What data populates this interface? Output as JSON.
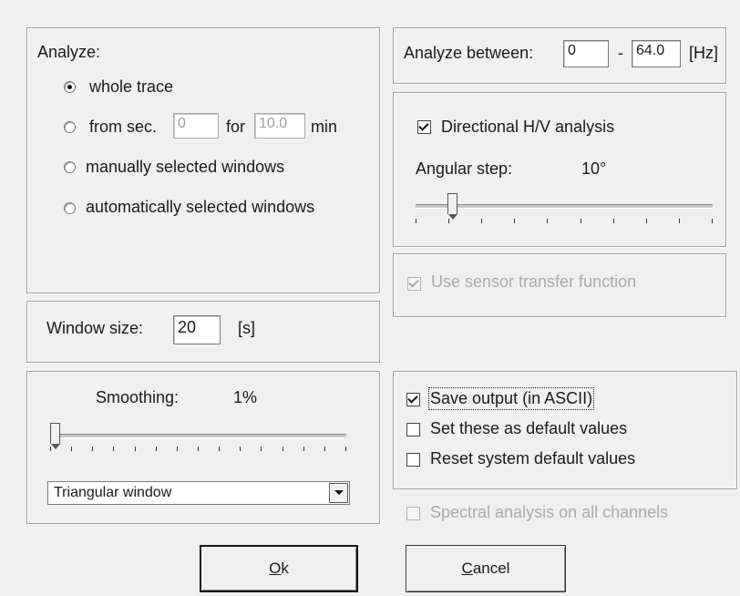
{
  "analyze": {
    "heading": "Analyze:",
    "options": [
      {
        "label": "whole trace",
        "selected": true
      },
      {
        "label": "from sec.",
        "selected": false
      },
      {
        "label": "manually selected windows",
        "selected": false
      },
      {
        "label": "automatically selected windows",
        "selected": false
      }
    ],
    "from_sec_value": "0",
    "for_label": "for",
    "for_value": "10.0",
    "min_label": "min"
  },
  "window_size": {
    "label": "Window size:",
    "value": "20",
    "unit": "[s]"
  },
  "smoothing": {
    "label": "Smoothing:",
    "value_text": "1%",
    "slider_fraction": 0.0,
    "window_type": "Triangular window"
  },
  "frequency": {
    "label": "Analyze between:",
    "from": "0",
    "dash": "-",
    "to": "64.0",
    "unit": "[Hz]"
  },
  "directional": {
    "checkbox_label": "Directional H/V analysis",
    "checked": true,
    "angular_label": "Angular step:",
    "angular_value": "10°",
    "slider_fraction": 0.111
  },
  "sensor_transfer": {
    "label": "Use sensor transfer function",
    "checked": true,
    "enabled": false
  },
  "output_options": {
    "save_output": {
      "label": "Save output (in ASCII)",
      "checked": true
    },
    "set_default": {
      "label": "Set these as default values",
      "checked": false
    },
    "reset_default": {
      "label": "Reset system default values",
      "checked": false
    }
  },
  "spectral_all": {
    "label": "Spectral analysis on all channels",
    "checked": false,
    "enabled": false
  },
  "buttons": {
    "ok": "Ok",
    "cancel": "Cancel"
  }
}
